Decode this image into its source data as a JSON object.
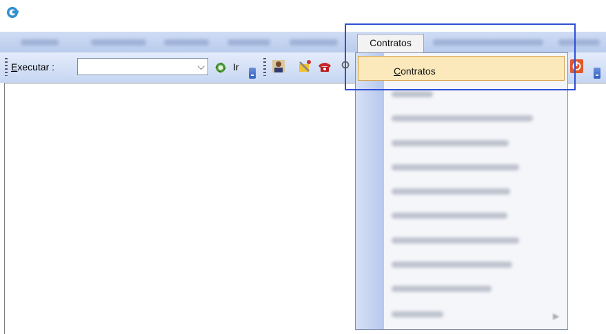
{
  "menubar": {
    "active_menu": "Contratos"
  },
  "toolbar": {
    "execute_label_accel": "E",
    "execute_label_rest": "xecutar :",
    "execute_value": "",
    "go_label": "Ir"
  },
  "dropdown": {
    "selected_item_accel": "C",
    "selected_item_rest": "ontratos"
  },
  "colors": {
    "menubar": "#c3d3ef",
    "highlight": "#fbe8bb",
    "focus_box": "#2e4ed6"
  },
  "icons": [
    "app-logo-icon",
    "go-icon",
    "toolbar-person-icon",
    "toolbar-tools-icon",
    "toolbar-phone-icon",
    "toolbar-search-icon",
    "toolbar-exit-icon"
  ]
}
